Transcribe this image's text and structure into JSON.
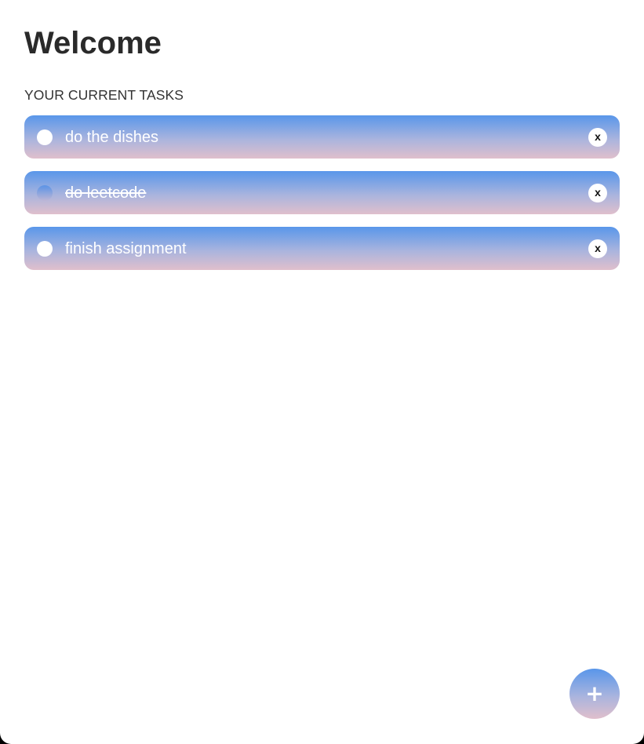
{
  "header": {
    "title": "Welcome"
  },
  "tasks_section": {
    "label": "YOUR CURRENT TASKS",
    "tasks": [
      {
        "text": "do the dishes",
        "completed": false,
        "delete_label": "x"
      },
      {
        "text": "do leetcode",
        "completed": true,
        "delete_label": "x"
      },
      {
        "text": "finish assignment",
        "completed": false,
        "delete_label": "x"
      }
    ]
  },
  "fab": {
    "label": "+",
    "icon": "plus-icon"
  },
  "colors": {
    "gradient_top": "#5996ea",
    "gradient_bottom": "#e0bfcc",
    "background": "#ffffff",
    "title_text": "#2a2a2a"
  }
}
